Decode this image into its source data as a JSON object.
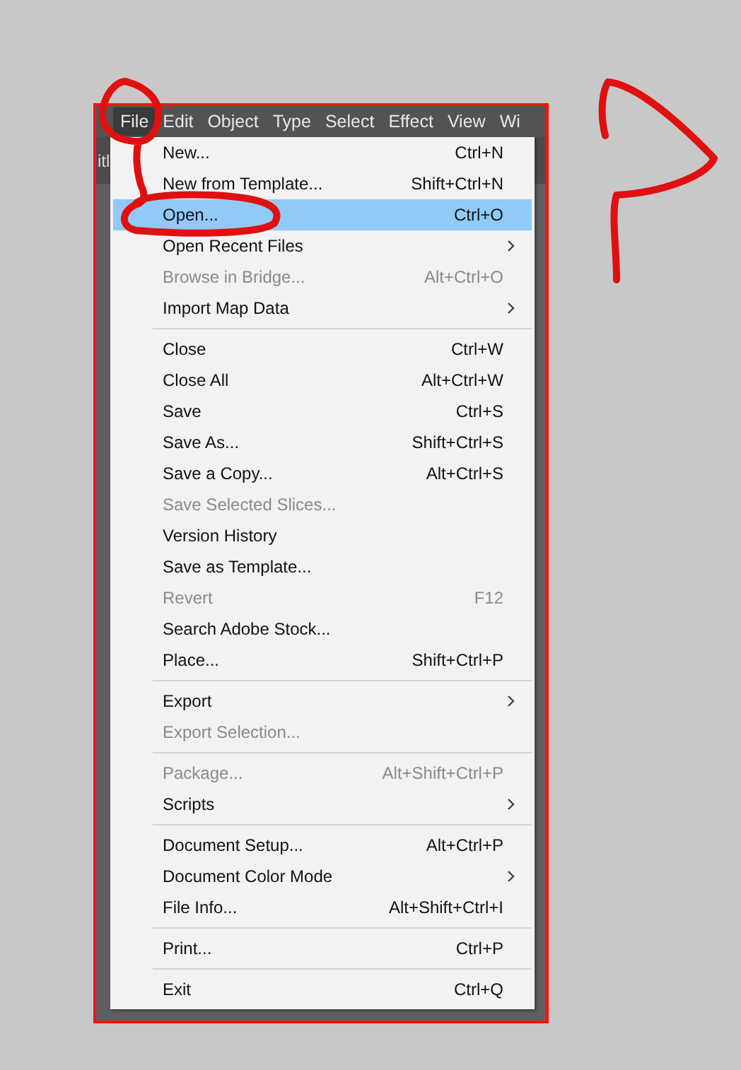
{
  "menu_bar": [
    {
      "label": "File",
      "selected": true
    },
    {
      "label": "Edit",
      "selected": false
    },
    {
      "label": "Object",
      "selected": false
    },
    {
      "label": "Type",
      "selected": false
    },
    {
      "label": "Select",
      "selected": false
    },
    {
      "label": "Effect",
      "selected": false
    },
    {
      "label": "View",
      "selected": false
    },
    {
      "label": "Wi",
      "selected": false
    }
  ],
  "document_tab": {
    "label": "itl"
  },
  "file_menu": [
    {
      "kind": "item",
      "label": "New...",
      "shortcut": "Ctrl+N",
      "disabled": false,
      "selected": false,
      "submenu": false
    },
    {
      "kind": "item",
      "label": "New from Template...",
      "shortcut": "Shift+Ctrl+N",
      "disabled": false,
      "selected": false,
      "submenu": false
    },
    {
      "kind": "item",
      "label": "Open...",
      "shortcut": "Ctrl+O",
      "disabled": false,
      "selected": true,
      "submenu": false
    },
    {
      "kind": "item",
      "label": "Open Recent Files",
      "disabled": false,
      "selected": false,
      "submenu": true
    },
    {
      "kind": "item",
      "label": "Browse in Bridge...",
      "shortcut": "Alt+Ctrl+O",
      "disabled": true,
      "selected": false,
      "submenu": false
    },
    {
      "kind": "item",
      "label": "Import Map Data",
      "disabled": false,
      "selected": false,
      "submenu": true
    },
    {
      "kind": "separator"
    },
    {
      "kind": "item",
      "label": "Close",
      "shortcut": "Ctrl+W",
      "disabled": false,
      "selected": false,
      "submenu": false
    },
    {
      "kind": "item",
      "label": "Close All",
      "shortcut": "Alt+Ctrl+W",
      "disabled": false,
      "selected": false,
      "submenu": false
    },
    {
      "kind": "item",
      "label": "Save",
      "shortcut": "Ctrl+S",
      "disabled": false,
      "selected": false,
      "submenu": false
    },
    {
      "kind": "item",
      "label": "Save As...",
      "shortcut": "Shift+Ctrl+S",
      "disabled": false,
      "selected": false,
      "submenu": false
    },
    {
      "kind": "item",
      "label": "Save a Copy...",
      "shortcut": "Alt+Ctrl+S",
      "disabled": false,
      "selected": false,
      "submenu": false
    },
    {
      "kind": "item",
      "label": "Save Selected Slices...",
      "disabled": true,
      "selected": false,
      "submenu": false
    },
    {
      "kind": "item",
      "label": "Version History",
      "disabled": false,
      "selected": false,
      "submenu": false
    },
    {
      "kind": "item",
      "label": "Save as Template...",
      "disabled": false,
      "selected": false,
      "submenu": false
    },
    {
      "kind": "item",
      "label": "Revert",
      "shortcut": "F12",
      "disabled": true,
      "selected": false,
      "submenu": false
    },
    {
      "kind": "item",
      "label": "Search Adobe Stock...",
      "disabled": false,
      "selected": false,
      "submenu": false
    },
    {
      "kind": "item",
      "label": "Place...",
      "shortcut": "Shift+Ctrl+P",
      "disabled": false,
      "selected": false,
      "submenu": false
    },
    {
      "kind": "separator"
    },
    {
      "kind": "item",
      "label": "Export",
      "disabled": false,
      "selected": false,
      "submenu": true
    },
    {
      "kind": "item",
      "label": "Export Selection...",
      "disabled": true,
      "selected": false,
      "submenu": false
    },
    {
      "kind": "separator"
    },
    {
      "kind": "item",
      "label": "Package...",
      "shortcut": "Alt+Shift+Ctrl+P",
      "disabled": true,
      "selected": false,
      "submenu": false
    },
    {
      "kind": "item",
      "label": "Scripts",
      "disabled": false,
      "selected": false,
      "submenu": true
    },
    {
      "kind": "separator"
    },
    {
      "kind": "item",
      "label": "Document Setup...",
      "shortcut": "Alt+Ctrl+P",
      "disabled": false,
      "selected": false,
      "submenu": false
    },
    {
      "kind": "item",
      "label": "Document Color Mode",
      "disabled": false,
      "selected": false,
      "submenu": true
    },
    {
      "kind": "item",
      "label": "File Info...",
      "shortcut": "Alt+Shift+Ctrl+I",
      "disabled": false,
      "selected": false,
      "submenu": false
    },
    {
      "kind": "separator"
    },
    {
      "kind": "item",
      "label": "Print...",
      "shortcut": "Ctrl+P",
      "disabled": false,
      "selected": false,
      "submenu": false
    },
    {
      "kind": "separator"
    },
    {
      "kind": "item",
      "label": "Exit",
      "shortcut": "Ctrl+Q",
      "disabled": false,
      "selected": false,
      "submenu": false
    }
  ]
}
